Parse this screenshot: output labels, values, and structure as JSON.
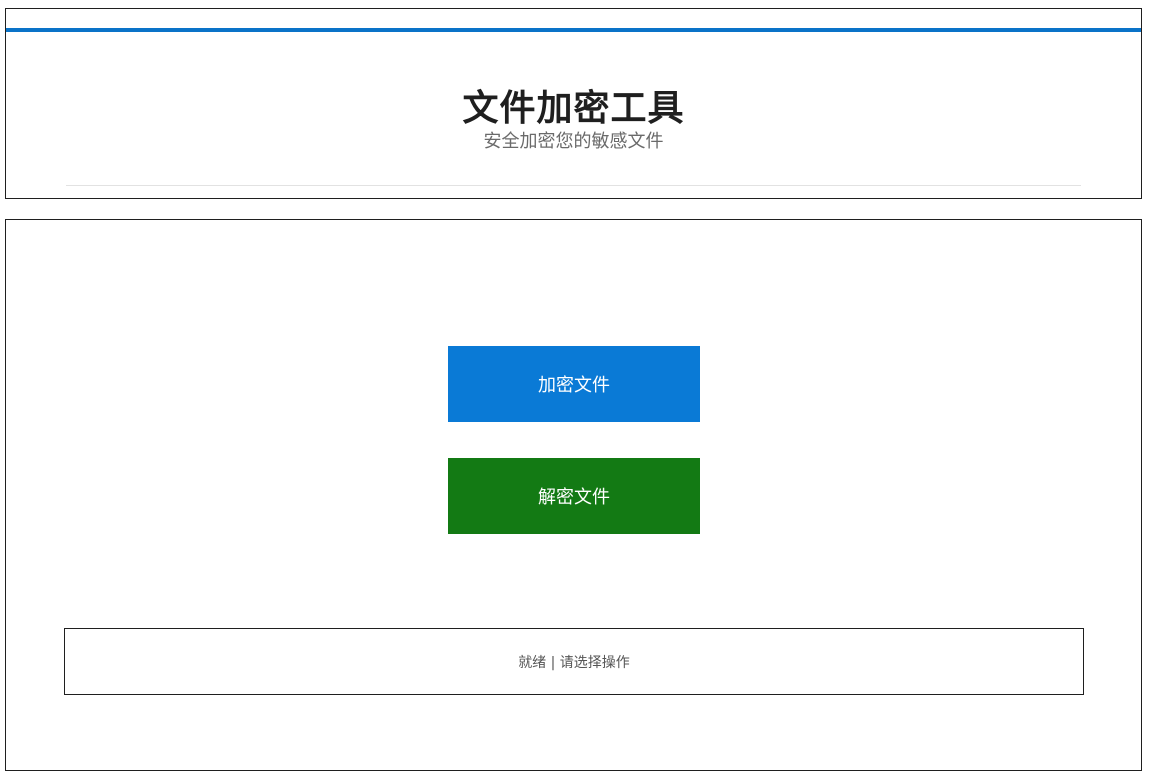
{
  "header": {
    "title": "文件加密工具",
    "subtitle": "安全加密您的敏感文件",
    "accent_color": "#0a73c8"
  },
  "actions": {
    "encrypt": {
      "label": "加密文件",
      "color": "#0a7ad6"
    },
    "decrypt": {
      "label": "解密文件",
      "color": "#137a14"
    }
  },
  "status": {
    "text": "就绪 | 请选择操作"
  }
}
